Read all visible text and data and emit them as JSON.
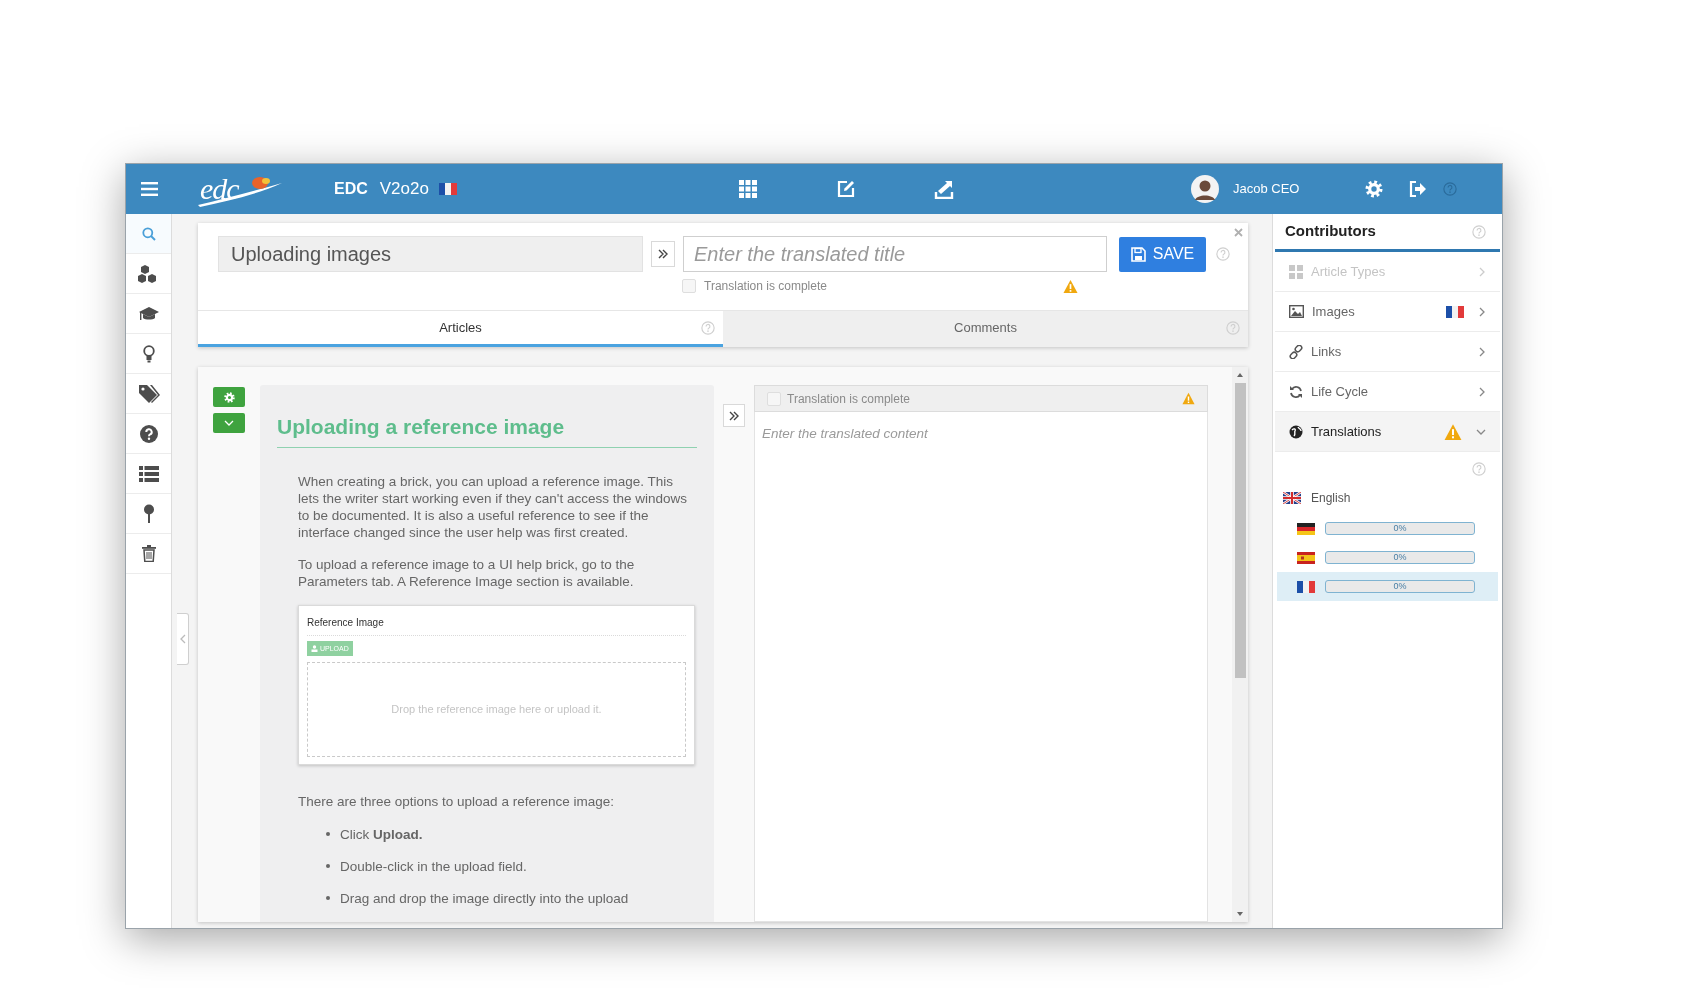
{
  "top_bar": {
    "logo": "edc",
    "product": "EDC",
    "version": "V2o2o",
    "user": "Jacob CEO",
    "flag": {
      "kind": "fr"
    }
  },
  "nav": [
    {
      "kind": "search",
      "selected": true
    },
    {
      "kind": "cubes",
      "selected": false
    },
    {
      "kind": "cap",
      "selected": false
    },
    {
      "kind": "bulb",
      "selected": false
    },
    {
      "kind": "tags",
      "selected": false
    },
    {
      "kind": "question",
      "selected": false
    },
    {
      "kind": "list",
      "selected": false
    },
    {
      "kind": "pin",
      "selected": false
    },
    {
      "kind": "trash",
      "selected": false
    }
  ],
  "title_bar": {
    "source_title": "Uploading images",
    "translated_title": {
      "placeholder": "Enter the translated title"
    },
    "save": "SAVE",
    "complete": {
      "label": "Translation is complete",
      "checked": false
    },
    "warning": true
  },
  "tabs": [
    {
      "label": "Articles",
      "selected": true
    },
    {
      "label": "Comments",
      "selected": false
    }
  ],
  "article": {
    "heading": "Uploading a reference image",
    "blocks": [
      {
        "kind": "paragraph",
        "text": "When creating a brick, you can upload a reference image. This lets the writer start working even if they can't access the windows to be documented. It is also a useful reference to see if the interface changed since the user help was first created."
      },
      {
        "kind": "paragraph",
        "text": "To upload a reference image to a UI help brick, go to the Parameters tab. A Reference Image section is available."
      },
      {
        "kind": "reference_image",
        "title": "Reference Image",
        "button": "UPLOAD",
        "drop_hint": "Drop the reference image here or upload it."
      },
      {
        "kind": "paragraph",
        "text": "There are three options to upload a reference image:"
      },
      {
        "kind": "bullets",
        "items": [
          "Click **Upload.**",
          "Double-click in the upload field.",
          "Drag and drop the image directly into the upload"
        ]
      }
    ]
  },
  "translation": {
    "complete": {
      "label": "Translation is complete",
      "checked": false
    },
    "warning": true,
    "content": {
      "placeholder": "Enter the translated content"
    }
  },
  "contributors": {
    "title": "Contributors",
    "items": [
      {
        "kind": "article_types",
        "label": "Article Types",
        "disabled": true,
        "expanded": false,
        "warning": false
      },
      {
        "kind": "images",
        "label": "Images",
        "flag": {
          "kind": "fr"
        },
        "disabled": false,
        "expanded": false,
        "warning": false
      },
      {
        "kind": "links",
        "label": "Links",
        "disabled": false,
        "expanded": false,
        "warning": false
      },
      {
        "kind": "life_cycle",
        "label": "Life Cycle",
        "disabled": false,
        "expanded": false,
        "warning": false
      },
      {
        "kind": "translations",
        "label": "Translations",
        "disabled": false,
        "expanded": true,
        "warning": true
      }
    ],
    "source_language": {
      "flag": {
        "kind": "uk"
      },
      "label": "English"
    },
    "languages": [
      {
        "flag": {
          "kind": "de"
        },
        "reading": "0%",
        "level": 0,
        "selected": false
      },
      {
        "flag": {
          "kind": "es"
        },
        "reading": "0%",
        "level": 0,
        "selected": false
      },
      {
        "flag": {
          "kind": "fr"
        },
        "reading": "0%",
        "level": 0,
        "selected": true
      }
    ]
  }
}
